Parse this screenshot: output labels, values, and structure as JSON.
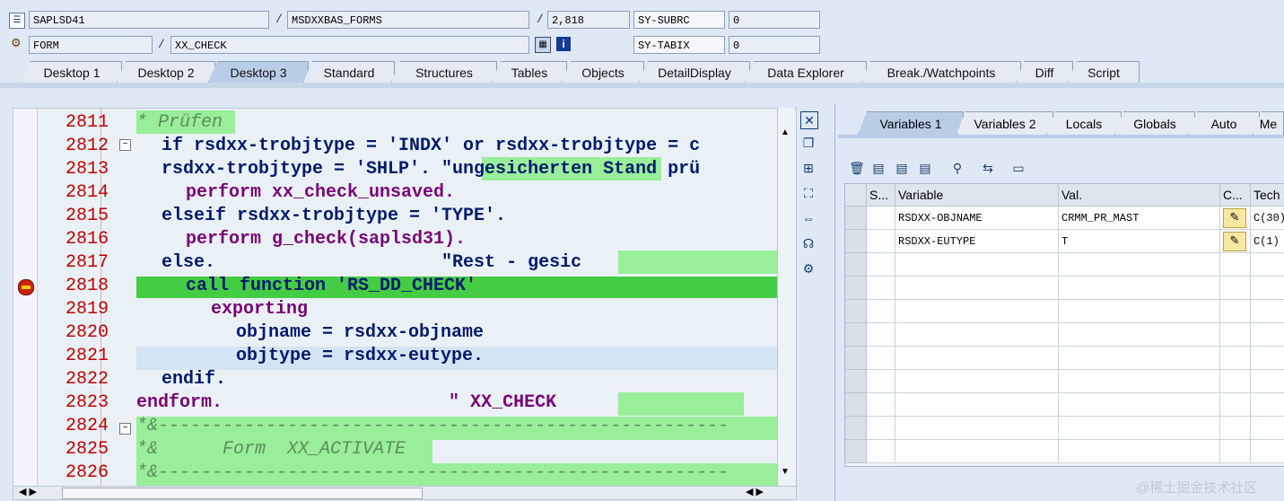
{
  "header": {
    "program": "SAPLSD41",
    "include": "MSDXXBAS_FORMS",
    "line": "2,818",
    "subrc_label": "SY-SUBRC",
    "subrc_value": "0",
    "event_type": "FORM",
    "event_name": "XX_CHECK",
    "tabix_label": "SY-TABIX",
    "tabix_value": "0",
    "separator": "/"
  },
  "tabs": [
    "Desktop 1",
    "Desktop 2",
    "Desktop 3",
    "Standard",
    "Structures",
    "Tables",
    "Objects",
    "DetailDisplay",
    "Data Explorer",
    "Break./Watchpoints",
    "Diff",
    "Script"
  ],
  "active_tab": "Desktop 3",
  "editor": {
    "lines": [
      {
        "num": "2811",
        "text": "* Prüfen"
      },
      {
        "num": "2812",
        "text": "if rsdxx-trobjtype = 'INDX' or rsdxx-trobjtype = c"
      },
      {
        "num": "2813",
        "text": "rsdxx-trobjtype = 'SHLP'. \"ungesicherten Stand prü"
      },
      {
        "num": "2814",
        "text": "perform xx_check_unsaved."
      },
      {
        "num": "2815",
        "text": "elseif rsdxx-trobjtype = 'TYPE'."
      },
      {
        "num": "2816",
        "text": "perform g_check(saplsd31)."
      },
      {
        "num": "2817",
        "text": "else.                     \"Rest - gesic"
      },
      {
        "num": "2818",
        "text": "call function 'RS_DD_CHECK'"
      },
      {
        "num": "2819",
        "text": "exporting"
      },
      {
        "num": "2820",
        "text": "objname = rsdxx-objname"
      },
      {
        "num": "2821",
        "text": "objtype = rsdxx-eutype."
      },
      {
        "num": "2822",
        "text": "endif."
      },
      {
        "num": "2823",
        "text": "endform.                     \" XX_CHECK"
      },
      {
        "num": "2824",
        "text": "*&-----------------------------------------------------"
      },
      {
        "num": "2825",
        "text": "*&      Form  XX_ACTIVATE"
      },
      {
        "num": "2826",
        "text": "*&-----------------------------------------------------"
      }
    ]
  },
  "vars": {
    "tabs": [
      "Variables 1",
      "Variables 2",
      "Locals",
      "Globals",
      "Auto",
      "Me"
    ],
    "active": "Variables 1",
    "columns": [
      "S...",
      "Variable",
      "Val.",
      "C...",
      "Tech"
    ],
    "rows": [
      {
        "variable": "RSDXX-OBJNAME",
        "value": "CRMM_PR_MAST",
        "tech": "C(30)"
      },
      {
        "variable": "RSDXX-EUTYPE",
        "value": "T",
        "tech": "C(1)"
      }
    ]
  },
  "watermark": "@稀土掘金技术社区"
}
